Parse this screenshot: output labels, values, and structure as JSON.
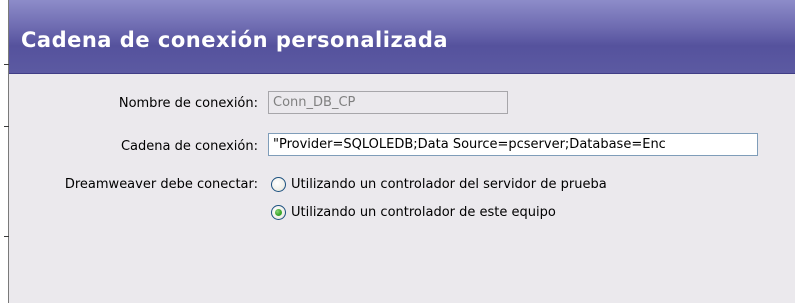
{
  "dialog": {
    "title": "Cadena de conexión personalizada"
  },
  "form": {
    "connection_name": {
      "label": "Nombre de conexión:",
      "value": "Conn_DB_CP"
    },
    "connection_string": {
      "label": "Cadena de conexión:",
      "value": "\"Provider=SQLOLEDB;Data Source=pcserver;Database=Enc"
    },
    "connect_via": {
      "label": "Dreamweaver debe conectar:",
      "options": [
        {
          "label": "Utilizando un controlador del servidor de prueba",
          "selected": false
        },
        {
          "label": "Utilizando un controlador de este equipo",
          "selected": true
        }
      ]
    }
  }
}
